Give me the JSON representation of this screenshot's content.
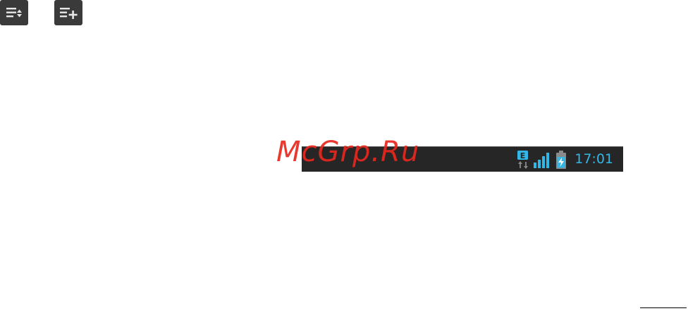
{
  "toolbar_icons": {
    "sort_icon": "sort-list-icon",
    "add_icon": "add-to-list-icon"
  },
  "status_bar": {
    "network_type": "E",
    "time": "17:01",
    "signal_icon": "signal-strength-icon",
    "battery_icon": "battery-charging-icon",
    "accent_color": "#33b5e5",
    "background_color": "#262626"
  },
  "watermark": {
    "text": "McGrp.Ru",
    "color": "#e8281e"
  }
}
